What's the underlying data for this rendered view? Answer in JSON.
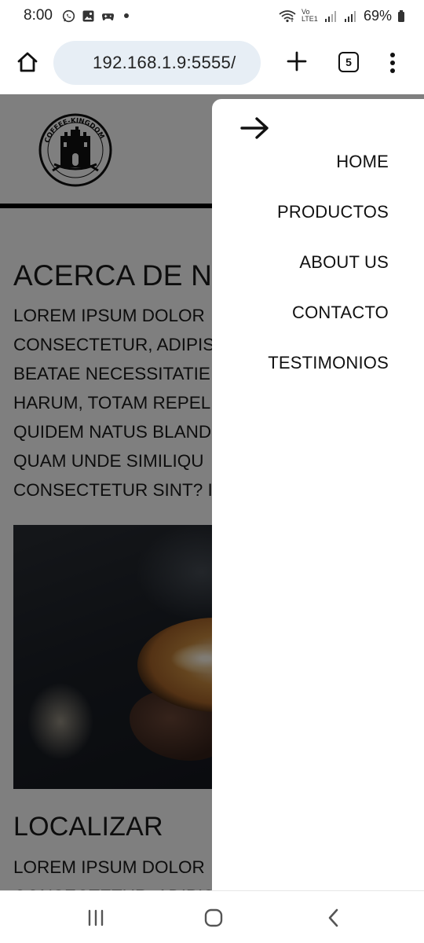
{
  "status_bar": {
    "time": "8:00",
    "battery": "69%",
    "network_label": "Vo LTE1",
    "icons": [
      "whatsapp-icon",
      "gallery-icon",
      "game-controller-icon",
      "notification-dot-icon",
      "wifi-icon",
      "signal-icon",
      "battery-icon"
    ]
  },
  "browser": {
    "url": "192.168.1.9:5555/",
    "tab_count": "5",
    "icons": [
      "home-icon",
      "new-tab-plus-icon",
      "tabs-counter-icon",
      "more-vert-icon"
    ]
  },
  "site": {
    "logo_text": "COFFEE-KINGDOM",
    "about_title": "ACERCA DE NOSOTROS",
    "about_lines": [
      "LOREM IPSUM DOLOR",
      "CONSECTETUR, ADIPIS",
      "BEATAE NECESSITATIE",
      "HARUM, TOTAM REPEL",
      "QUIDEM NATUS BLAND",
      "QUAM UNDE SIMILIQU",
      "CONSECTETUR SINT? I"
    ],
    "localizar_title": "LOCALIZAR",
    "localizar_lines": [
      "LOREM IPSUM DOLOR",
      "CONSECTETUR, ADIPIS"
    ]
  },
  "drawer": {
    "close_icon": "arrow-right-icon",
    "items": [
      {
        "label": "HOME"
      },
      {
        "label": "PRODUCTOS"
      },
      {
        "label": "ABOUT US"
      },
      {
        "label": "CONTACTO"
      },
      {
        "label": "TESTIMONIOS"
      }
    ]
  },
  "system_nav": {
    "icons": [
      "recent-apps-icon",
      "home-circle-icon",
      "back-chevron-icon"
    ]
  },
  "colors": {
    "url_pill": "#e7eef5",
    "overlay": "rgba(0,0,0,0.5)",
    "drawer_bg": "#ffffff",
    "text": "#111111"
  }
}
